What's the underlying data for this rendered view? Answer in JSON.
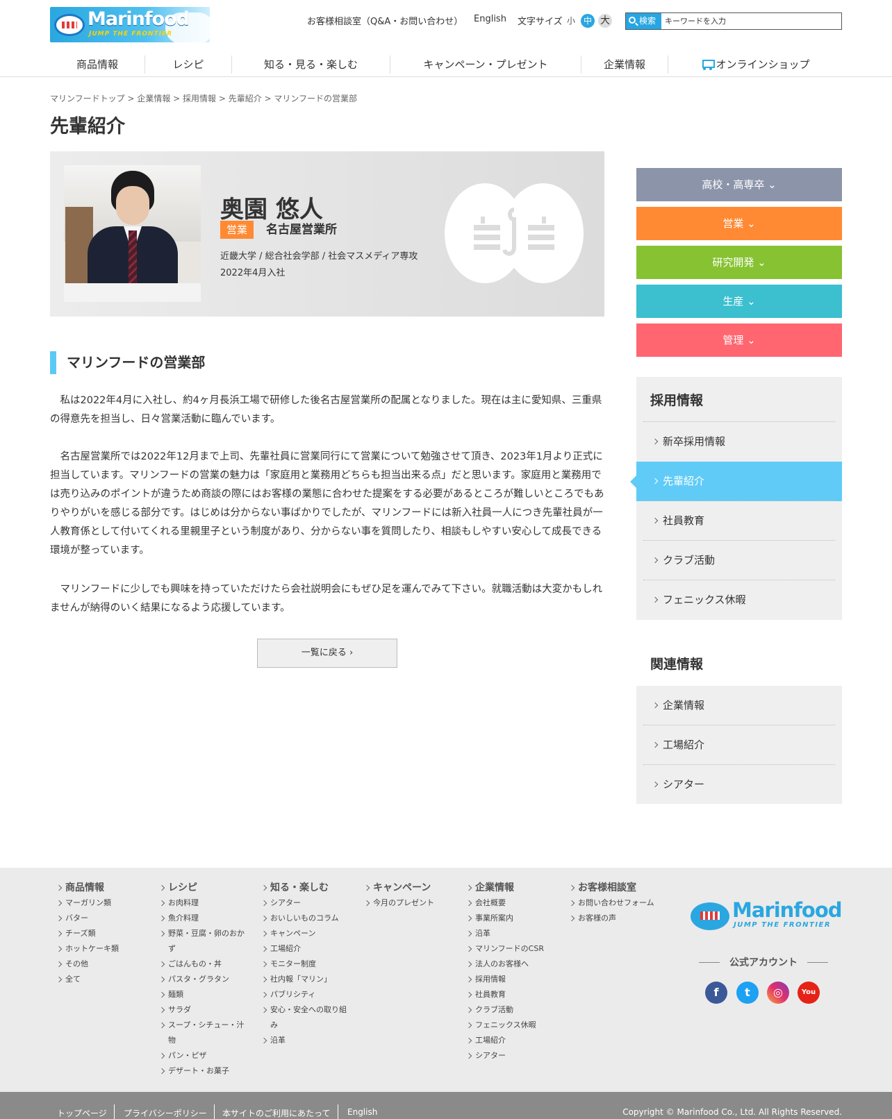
{
  "header": {
    "logo_text": "Marinfood",
    "logo_tagline": "JUMP THE FRONTIER",
    "consult": "お客様相談室（Q&A・お問い合わせ）",
    "english": "English",
    "font_size_label": "文字サイズ",
    "font_small": "小",
    "font_medium": "中",
    "font_large": "大",
    "search_label": "検索",
    "search_placeholder": "キーワードを入力"
  },
  "nav": [
    "商品情報",
    "レシピ",
    "知る・見る・楽しむ",
    "キャンペーン・プレゼント",
    "企業情報",
    "オンラインショップ"
  ],
  "breadcrumb": "マリンフードトップ > 企業情報 > 採用情報 > 先輩紹介 > マリンフードの営業部",
  "page_title": "先輩紹介",
  "profile": {
    "name": "奥園 悠人",
    "department": "営業",
    "office": "名古屋営業所",
    "school": "近畿大学 / 総合社会学部 / 社会マスメディア専攻",
    "joined": "2022年4月入社"
  },
  "article": {
    "heading": "マリンフードの営業部",
    "paragraphs": [
      "私は2022年4月に入社し、約4ヶ月長浜工場で研修した後名古屋営業所の配属となりました。現在は主に愛知県、三重県の得意先を担当し、日々営業活動に臨んでいます。",
      "名古屋営業所では2022年12月まで上司、先輩社員に営業同行にて営業について勉強させて頂き、2023年1月より正式に担当しています。マリンフードの営業の魅力は「家庭用と業務用どちらも担当出来る点」だと思います。家庭用と業務用では売り込みのポイントが違うため商談の際にはお客様の業態に合わせた提案をする必要があるところが難しいところでもありやりがいを感じる部分です。はじめは分からない事ばかりでしたが、マリンフードには新入社員一人につき先輩社員が一人教育係として付いてくれる里親里子という制度があり、分からない事を質問したり、相談もしやすい安心して成長できる環境が整っています。",
      "マリンフードに少しでも興味を持っていただけたら会社説明会にもぜひ足を運んでみて下さい。就職活動は大変かもしれませんが納得のいく結果になるよう応援しています。"
    ],
    "back_button": "一覧に戻る ›"
  },
  "sidebar": {
    "categories": [
      {
        "label": "高校・高専卒 ⌄",
        "color": "#8c94aa"
      },
      {
        "label": "営業 ⌄",
        "color": "#ff8a33"
      },
      {
        "label": "研究開発 ⌄",
        "color": "#86c232"
      },
      {
        "label": "生産 ⌄",
        "color": "#3cbfcf"
      },
      {
        "label": "管理 ⌄",
        "color": "#ff6670"
      }
    ],
    "recruit_title": "採用情報",
    "recruit_items": [
      "新卒採用情報",
      "先輩紹介",
      "社員教育",
      "クラブ活動",
      "フェニックス休暇"
    ],
    "related_title": "関連情報",
    "related_items": [
      "企業情報",
      "工場紹介",
      "シアター"
    ]
  },
  "footer": {
    "columns": [
      {
        "title": "商品情報",
        "links": [
          "マーガリン類",
          "バター",
          "チーズ類",
          "ホットケーキ類",
          "その他",
          "全て"
        ]
      },
      {
        "title": "レシピ",
        "links": [
          "お肉料理",
          "魚介料理",
          "野菜・豆腐・卵のおかず",
          "ごはんもの・丼",
          "パスタ・グラタン",
          "麺類",
          "サラダ",
          "スープ・シチュー・汁物",
          "パン・ピザ",
          "デザート・お菓子"
        ]
      },
      {
        "title": "知る・楽しむ",
        "links": [
          "シアター",
          "おいしいものコラム",
          "キャンペーン",
          "工場紹介",
          "モニター制度",
          "社内報「マリン」",
          "パブリシティ",
          "安心・安全への取り組み",
          "沿革"
        ]
      },
      {
        "title": "キャンペーン",
        "links": [
          "今月のプレゼント"
        ]
      },
      {
        "title": "企業情報",
        "links": [
          "会社概要",
          "事業所案内",
          "沿革",
          "マリンフードのCSR",
          "法人のお客様へ",
          "採用情報",
          "社員教育",
          "クラブ活動",
          "フェニックス休暇",
          "工場紹介",
          "シアター"
        ]
      },
      {
        "title": "お客様相談室",
        "links": [
          "お問い合わせフォーム",
          "お客様の声"
        ]
      }
    ],
    "official_accounts": "公式アカウント",
    "social": [
      "f",
      "t",
      "◎",
      "You"
    ],
    "bottom_links": [
      "トップページ",
      "プライバシーポリシー",
      "本サイトのご利用にあたって",
      "English"
    ],
    "copyright": "Copyright © Marinfood Co., Ltd. All Rights Reserved."
  }
}
